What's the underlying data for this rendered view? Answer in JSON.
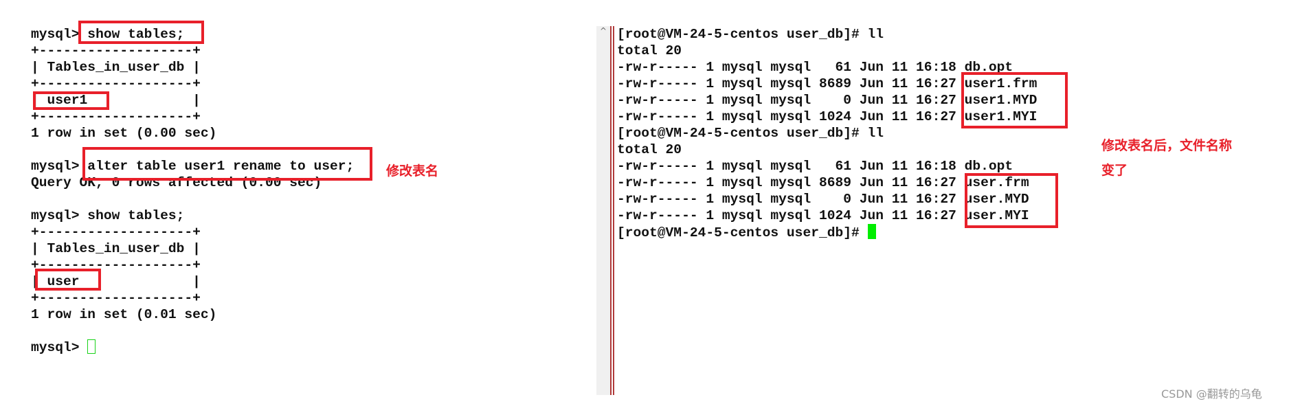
{
  "left_terminal": {
    "lines": [
      "mysql> show tables;",
      "+-------------------+",
      "| Tables_in_user_db |",
      "+-------------------+",
      "| user1             |",
      "+-------------------+",
      "1 row in set (0.00 sec)",
      "",
      "mysql> alter table user1 rename to user;",
      "Query OK, 0 rows affected (0.00 sec)",
      "",
      "mysql> show tables;",
      "+-------------------+",
      "| Tables_in_user_db |",
      "+-------------------+",
      "| user              |",
      "+-------------------+",
      "1 row in set (0.01 sec)",
      "",
      "mysql> "
    ]
  },
  "right_terminal": {
    "lines": [
      "[root@VM-24-5-centos user_db]# ll",
      "total 20",
      "-rw-r----- 1 mysql mysql   61 Jun 11 16:18 db.opt",
      "-rw-r----- 1 mysql mysql 8689 Jun 11 16:27 user1.frm",
      "-rw-r----- 1 mysql mysql    0 Jun 11 16:27 user1.MYD",
      "-rw-r----- 1 mysql mysql 1024 Jun 11 16:27 user1.MYI",
      "[root@VM-24-5-centos user_db]# ll",
      "total 20",
      "-rw-r----- 1 mysql mysql   61 Jun 11 16:18 db.opt",
      "-rw-r----- 1 mysql mysql 8689 Jun 11 16:27 user.frm",
      "-rw-r----- 1 mysql mysql    0 Jun 11 16:27 user.MYD",
      "-rw-r----- 1 mysql mysql 1024 Jun 11 16:27 user.MYI",
      "[root@VM-24-5-centos user_db]# "
    ]
  },
  "annotations": {
    "rename_note": "修改表名",
    "files_note_line1": "修改表名后，文件名称",
    "files_note_line2": "变了"
  },
  "watermark": "CSDN @翻转的乌龟",
  "colors": {
    "highlight": "#e8202a",
    "cursor": "#00ee00"
  }
}
